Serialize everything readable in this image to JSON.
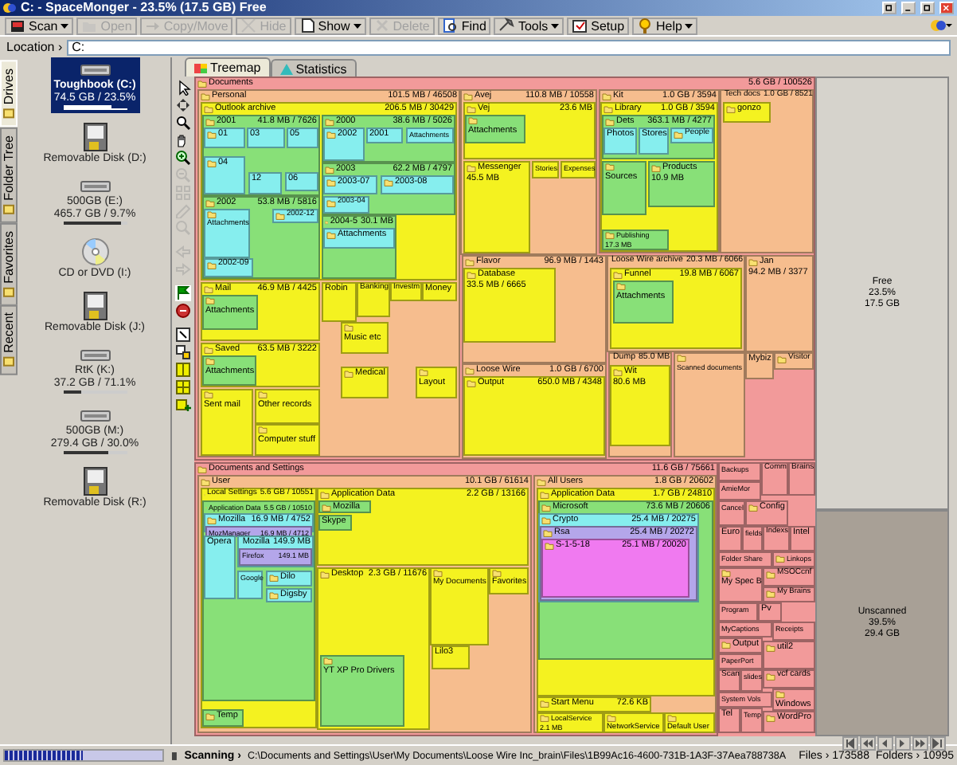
{
  "window": {
    "title": "C: - SpaceMonger - 23.5% (17.5 GB) Free"
  },
  "toolbar": [
    {
      "label": "Scan",
      "kind": "scan",
      "menu": true,
      "disabled": false
    },
    {
      "label": "Open",
      "kind": "open",
      "menu": false,
      "disabled": true
    },
    {
      "label": "Copy/Move",
      "kind": "copy",
      "menu": false,
      "disabled": true
    },
    {
      "label": "Hide",
      "kind": "hide",
      "menu": false,
      "disabled": true
    },
    {
      "label": "Show",
      "kind": "show",
      "menu": true,
      "disabled": false
    },
    {
      "label": "Delete",
      "kind": "delete",
      "menu": false,
      "disabled": true
    },
    {
      "label": "Find",
      "kind": "find",
      "menu": false,
      "disabled": false
    },
    {
      "label": "Tools",
      "kind": "tools",
      "menu": true,
      "disabled": false
    },
    {
      "label": "Setup",
      "kind": "setup",
      "menu": false,
      "disabled": false
    },
    {
      "label": "Help",
      "kind": "help",
      "menu": true,
      "disabled": false
    }
  ],
  "location": {
    "label": "Location ›",
    "value": "C:"
  },
  "side_tabs": [
    {
      "label": "Drives",
      "selected": true
    },
    {
      "label": "Folder Tree",
      "selected": false
    },
    {
      "label": "Favorites",
      "selected": false
    },
    {
      "label": "Recent",
      "selected": false
    }
  ],
  "drives": [
    {
      "label": "Toughbook (C:)",
      "usage": "74.5 GB / 23.5%",
      "level": 0.765,
      "kind": "hdd",
      "selected": true
    },
    {
      "label": "Removable Disk (D:)",
      "kind": "removable",
      "selected": false
    },
    {
      "label": "500GB (E:)",
      "usage": "465.7 GB / 9.7%",
      "level": 0.903,
      "kind": "hdd",
      "selected": false
    },
    {
      "label": "CD or DVD (I:)",
      "kind": "cd",
      "selected": false
    },
    {
      "label": "Removable Disk (J:)",
      "kind": "removable",
      "selected": false
    },
    {
      "label": "RtK (K:)",
      "usage": "37.2 GB / 71.1%",
      "level": 0.289,
      "kind": "hdd",
      "selected": false
    },
    {
      "label": "500GB (M:)",
      "usage": "279.4 GB / 30.0%",
      "level": 0.7,
      "kind": "hdd",
      "selected": false
    },
    {
      "label": "Removable Disk (R:)",
      "kind": "removable",
      "selected": false
    }
  ],
  "tools": [
    {
      "kind": "pointer",
      "disabled": false
    },
    {
      "kind": "move",
      "disabled": false
    },
    {
      "kind": "zoom",
      "disabled": false
    },
    {
      "kind": "hand",
      "disabled": false
    },
    {
      "kind": "zoom-in",
      "disabled": false
    },
    {
      "kind": "zoom-out",
      "disabled": true
    },
    {
      "kind": "grid",
      "disabled": true
    },
    {
      "kind": "pencil",
      "disabled": true
    },
    {
      "kind": "zoom-fit",
      "disabled": true
    },
    {
      "kind": "back",
      "disabled": true
    },
    {
      "kind": "forward",
      "disabled": true
    },
    {
      "kind": "flag",
      "disabled": false
    },
    {
      "kind": "stop",
      "disabled": false
    },
    {
      "kind": "select",
      "disabled": false
    },
    {
      "kind": "select-down",
      "disabled": false
    },
    {
      "kind": "column",
      "disabled": false
    },
    {
      "kind": "columns",
      "disabled": false
    },
    {
      "kind": "add",
      "disabled": false
    }
  ],
  "view_tabs": [
    {
      "label": "Treemap",
      "selected": true
    },
    {
      "label": "Statistics",
      "selected": false
    }
  ],
  "treemap": {
    "tiles": [
      {
        "name": "Documents",
        "size": "5.6 GB / 100526",
        "children": [
          {
            "name": "Personal",
            "size": "101.5 MB / 46508",
            "children": [
              {
                "name": "Outlook archive",
                "size": "206.5 MB / 30429",
                "children": [
                  {
                    "name": "2001",
                    "size": "41.8 MB / 7626",
                    "children": [
                      {
                        "name": "01"
                      },
                      {
                        "name": "03"
                      },
                      {
                        "name": "05"
                      },
                      {
                        "name": "04"
                      },
                      {
                        "name": "12"
                      },
                      {
                        "name": "06"
                      }
                    ]
                  },
                  {
                    "name": "2000",
                    "size": "38.6 MB / 5026",
                    "children": [
                      {
                        "name": "2002"
                      },
                      {
                        "name": "2001"
                      },
                      {
                        "name": "Attachments"
                      }
                    ]
                  },
                  {
                    "name": "2003",
                    "size": "62.2 MB / 4797",
                    "children": [
                      {
                        "name": "2003-07"
                      },
                      {
                        "name": "2003-08"
                      },
                      {
                        "name": "2003-04"
                      }
                    ]
                  },
                  {
                    "name": "2002",
                    "size": "53.8 MB / 5816",
                    "children": [
                      {
                        "name": "Attachments"
                      },
                      {
                        "name": "2002-12"
                      },
                      {
                        "name": "2002-09"
                      }
                    ]
                  },
                  {
                    "name": "2004-5",
                    "size": "30.1 MB",
                    "children": [
                      {
                        "name": "Attachments"
                      }
                    ]
                  }
                ]
              },
              {
                "name": "Mail",
                "size": "46.9 MB / 4425",
                "children": [
                  {
                    "name": "Attachments"
                  }
                ]
              },
              {
                "name": "Saved",
                "size": "63.5 MB / 3222",
                "children": [
                  {
                    "name": "Attachments"
                  }
                ]
              },
              {
                "name": "Sent mail"
              },
              {
                "name": "Other records"
              },
              {
                "name": "Computer stuff"
              },
              {
                "name": "Robin"
              },
              {
                "name": "Banking"
              },
              {
                "name": "Investm"
              },
              {
                "name": "Money"
              },
              {
                "name": "Music etc"
              },
              {
                "name": "Medical"
              },
              {
                "name": "Layout"
              }
            ]
          },
          {
            "name": "Avej",
            "size": "110.8 MB / 10558",
            "children": [
              {
                "name": "Vej",
                "size": "23.6 MB",
                "children": [
                  {
                    "name": "Attachments"
                  }
                ]
              },
              {
                "name": "Messenger",
                "size": "45.5 MB"
              },
              {
                "name": "Stories"
              },
              {
                "name": "Expenses"
              }
            ]
          },
          {
            "name": "Kit",
            "size": "1.0 GB / 3594",
            "children": [
              {
                "name": "Library",
                "size": "1.0 GB / 3594",
                "children": [
                  {
                    "name": "Dets",
                    "size": "363.1 MB / 4277",
                    "children": [
                      {
                        "name": "Photos"
                      },
                      {
                        "name": "Stores"
                      },
                      {
                        "name": "People"
                      }
                    ]
                  },
                  {
                    "name": "Sources"
                  },
                  {
                    "name": "Products",
                    "size": "10.9 MB"
                  },
                  {
                    "name": "Publishing",
                    "size": "17.3 MB"
                  }
                ]
              }
            ]
          },
          {
            "name": "Tech docs",
            "size": "1.0 GB / 8521",
            "children": [
              {
                "name": "gonzo"
              }
            ]
          },
          {
            "name": "Flavor",
            "size": "96.9 MB / 1443",
            "children": [
              {
                "name": "Database",
                "size": "33.5 MB / 6665"
              }
            ]
          },
          {
            "name": "Loose Wire archive",
            "size": "20.3 MB / 6066",
            "children": [
              {
                "name": "Funnel",
                "size": "19.8 MB / 6067",
                "children": [
                  {
                    "name": "Attachments"
                  }
                ]
              }
            ]
          },
          {
            "name": "Jan",
            "size": "94.2 MB / 3377"
          },
          {
            "name": "Loose Wire",
            "size": "1.0 GB / 6700",
            "children": [
              {
                "name": "Output",
                "size": "650.0 MB / 4348"
              }
            ]
          },
          {
            "name": "Dump",
            "size": "85.0 MB",
            "children": [
              {
                "name": "Wit",
                "size": "80.6 MB"
              }
            ]
          },
          {
            "name": "Scanned documents"
          },
          {
            "name": "Mybiz"
          },
          {
            "name": "Visitor"
          }
        ]
      },
      {
        "name": "Documents and Settings",
        "size": "11.6 GB / 75661",
        "children": [
          {
            "name": "User",
            "size": "10.1 GB / 61614",
            "children": [
              {
                "name": "Local Settings",
                "size": "5.6 GB / 10551",
                "children": [
                  {
                    "name": "Application Data",
                    "size": "5.5 GB / 10510",
                    "children": [
                      {
                        "name": "Mozilla",
                        "size": "16.9 MB / 4752",
                        "children": [
                          {
                            "name": "MozManager",
                            "size": "16.9 MB / 4712"
                          }
                        ]
                      },
                      {
                        "name": "Opera"
                      },
                      {
                        "name": "Mozilla",
                        "size": "149.9 MB",
                        "children": [
                          {
                            "name": "Firefox",
                            "size": "149.1 MB"
                          }
                        ]
                      },
                      {
                        "name": "Google"
                      },
                      {
                        "name": "Dilo"
                      },
                      {
                        "name": "Digsby"
                      }
                    ]
                  },
                  {
                    "name": "Temp"
                  }
                ]
              },
              {
                "name": "Application Data",
                "size": "2.2 GB / 13166",
                "children": [
                  {
                    "name": "Mozilla"
                  },
                  {
                    "name": "Skype"
                  }
                ]
              },
              {
                "name": "Desktop",
                "size": "2.3 GB / 11676",
                "children": [
                  {
                    "name": "YT XP Pro Drivers"
                  }
                ]
              },
              {
                "name": "My Documents"
              },
              {
                "name": "Favorites"
              },
              {
                "name": "Lilo3"
              }
            ]
          },
          {
            "name": "All Users",
            "size": "1.8 GB / 20602",
            "children": [
              {
                "name": "Application Data",
                "size": "1.7 GB / 24810",
                "children": [
                  {
                    "name": "Microsoft",
                    "size": "73.6 MB / 20606",
                    "children": [
                      {
                        "name": "Crypto",
                        "size": "25.4 MB / 20275",
                        "children": [
                          {
                            "name": "Rsa",
                            "size": "25.4 MB / 20272",
                            "children": [
                              {
                                "name": "S-1-5-18",
                                "size": "25.1 MB / 20020"
                              }
                            ]
                          }
                        ]
                      }
                    ]
                  }
                ]
              },
              {
                "name": "Start Menu",
                "size": "72.6 KB"
              },
              {
                "name": "LocalService",
                "size": "2.1 MB"
              },
              {
                "name": "NetworkService"
              },
              {
                "name": "Default User"
              }
            ]
          }
        ]
      },
      {
        "name": "Backups"
      },
      {
        "name": "Comm"
      },
      {
        "name": "Brains"
      },
      {
        "name": "AmieMor"
      },
      {
        "name": "Cancel"
      },
      {
        "name": "Config"
      },
      {
        "name": "Euro"
      },
      {
        "name": "fields"
      },
      {
        "name": "Indexs"
      },
      {
        "name": "Intel"
      },
      {
        "name": "Folder Share"
      },
      {
        "name": "Linkops"
      },
      {
        "name": "MSOCcnf"
      },
      {
        "name": "My Brains"
      },
      {
        "name": "My Spec B"
      },
      {
        "name": "Program"
      },
      {
        "name": "Pv"
      },
      {
        "name": "MyCaptions"
      },
      {
        "name": "Receipts"
      },
      {
        "name": "Output"
      },
      {
        "name": "PaperPort"
      },
      {
        "name": "Scan"
      },
      {
        "name": "slides"
      },
      {
        "name": "util2"
      },
      {
        "name": "vcf cards"
      },
      {
        "name": "System Vols"
      },
      {
        "name": "Windows"
      },
      {
        "name": "Tel"
      },
      {
        "name": "Temp"
      },
      {
        "name": "WordPro"
      }
    ],
    "free": {
      "label": "Free",
      "percent": "23.5%",
      "size": "17.5 GB"
    },
    "unscanned": {
      "label": "Unscanned",
      "percent": "39.5%",
      "size": "29.4 GB"
    }
  },
  "pager": [
    {
      "kind": "first"
    },
    {
      "kind": "prev-page"
    },
    {
      "kind": "prev"
    },
    {
      "kind": "next"
    },
    {
      "kind": "next-page"
    },
    {
      "kind": "last"
    }
  ],
  "status_bar": {
    "level": 0.5,
    "label": "Scanning ›",
    "path": "C:\\Documents and Settings\\User\\My Documents\\Loose Wire Inc_brain\\Files\\1B99Ac16-4600-731B-1A3F-37Aea788738A",
    "files": "Files › 173588",
    "folders": "Folders › 10995"
  }
}
